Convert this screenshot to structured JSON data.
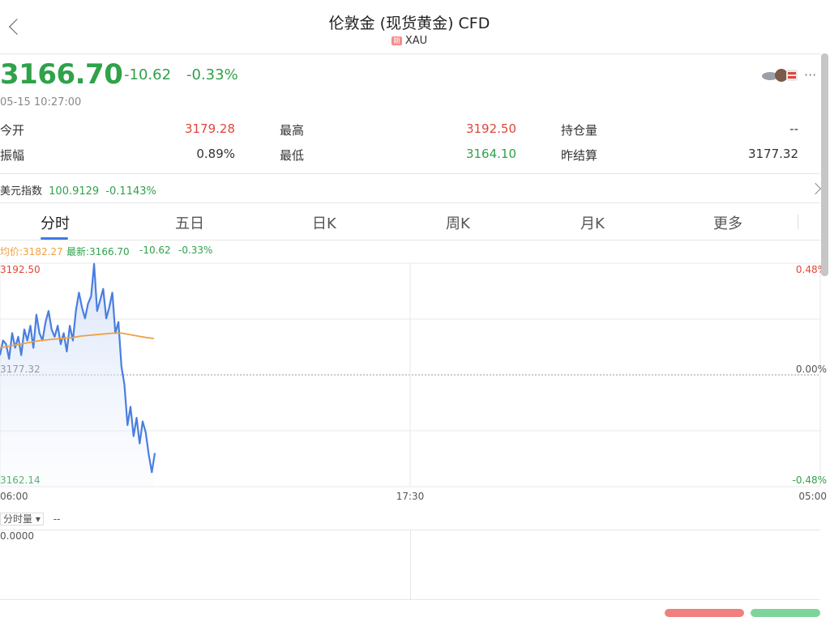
{
  "header": {
    "title": "伦敦金 (现货黄金) CFD",
    "badge": "期",
    "symbol": "XAU"
  },
  "quote": {
    "price": "3166.70",
    "change": "-10.62",
    "change_pct": "-0.33%",
    "time": "05-15 10:27:00",
    "more": "···"
  },
  "stats": [
    {
      "label": "今开",
      "value": "3179.28",
      "color": "red"
    },
    {
      "label": "最高",
      "value": "3192.50",
      "color": "red"
    },
    {
      "label": "持仓量",
      "value": "--",
      "color": "dark"
    },
    {
      "label": "振幅",
      "value": "0.89%",
      "color": "dark"
    },
    {
      "label": "最低",
      "value": "3164.10",
      "color": "green"
    },
    {
      "label": "昨结算",
      "value": "3177.32",
      "color": "dark"
    }
  ],
  "usd_index": {
    "label": "美元指数",
    "value": "100.9129",
    "change": "-0.1143%"
  },
  "tabs": [
    "分时",
    "五日",
    "日K",
    "周K",
    "月K",
    "更多"
  ],
  "legend": {
    "avg": "均价:3182.27",
    "latest": "最新:3166.70",
    "change": "-10.62",
    "pct": "-0.33%"
  },
  "colors": {
    "up": "#e0463a",
    "down": "#2fa24a",
    "line": "#4a7ee0",
    "avg": "#f0a040",
    "accent": "#3f7be8"
  },
  "chart_data": {
    "type": "line",
    "y_left_ticks": [
      "3192.50",
      "3177.32",
      "3162.14"
    ],
    "y_right_ticks": [
      "0.48%",
      "0.00%",
      "-0.48%"
    ],
    "x_ticks": [
      "06:00",
      "17:30",
      "05:00"
    ],
    "ylim": [
      3162.14,
      3192.5
    ],
    "reference": 3177.32,
    "series": [
      {
        "values": [
          3180.0,
          3182.0,
          3181.5,
          3179.5,
          3183.0,
          3181.0,
          3182.5,
          3180.0,
          3183.5,
          3182.0,
          3184.0,
          3181.0,
          3185.5,
          3183.0,
          3182.0,
          3184.5,
          3186.0,
          3183.5,
          3182.5,
          3184.0,
          3181.5,
          3183.0,
          3180.5,
          3184.0,
          3182.0,
          3186.0,
          3188.5,
          3186.5,
          3185.0,
          3187.0,
          3188.0,
          3192.4,
          3186.0,
          3187.5,
          3189.0,
          3185.0,
          3186.5,
          3188.5,
          3183.0,
          3184.5,
          3178.5,
          3176.0,
          3170.5,
          3173.0,
          3169.0,
          3171.5,
          3168.0,
          3171.0,
          3169.5,
          3166.5,
          3164.1,
          3166.7
        ]
      },
      {
        "values": [
          3181.0,
          3181.2,
          3181.4,
          3181.6,
          3181.8,
          3182.0,
          3182.1,
          3182.2,
          3182.3,
          3182.4,
          3182.6,
          3182.7,
          3182.8,
          3182.9,
          3183.0,
          3183.0,
          3182.8,
          3182.6,
          3182.4,
          3182.27
        ]
      }
    ]
  },
  "volume": {
    "label": "分时量",
    "value": "--",
    "tick": "0.0000"
  }
}
